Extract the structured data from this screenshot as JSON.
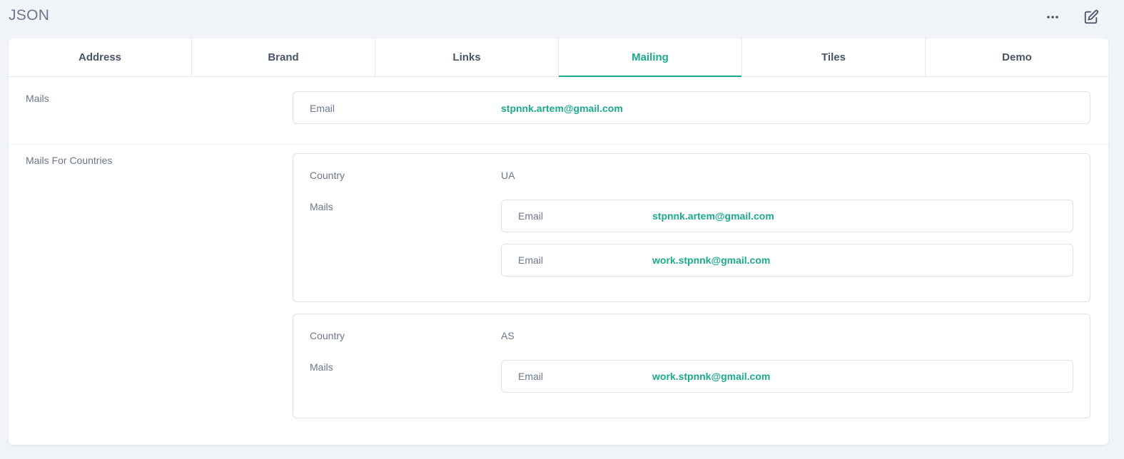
{
  "header": {
    "title": "JSON",
    "actions": [
      {
        "icon": "more-icon"
      },
      {
        "icon": "edit-icon"
      }
    ]
  },
  "tabs": [
    {
      "label": "Address"
    },
    {
      "label": "Brand"
    },
    {
      "label": "Links"
    },
    {
      "label": "Mailing"
    },
    {
      "label": "Tiles"
    },
    {
      "label": "Demo"
    }
  ],
  "active_tab": "Mailing",
  "mails": {
    "label": "Mails",
    "items": [
      {
        "key": "Email",
        "value": "stpnnk.artem@gmail.com"
      }
    ]
  },
  "mails_for_countries": {
    "label": "Mails For Countries",
    "entries": [
      {
        "country_key": "Country",
        "country": "UA",
        "mails_key": "Mails",
        "mails": [
          {
            "key": "Email",
            "value": "stpnnk.artem@gmail.com"
          },
          {
            "key": "Email",
            "value": "work.stpnnk@gmail.com"
          }
        ]
      },
      {
        "country_key": "Country",
        "country": "AS",
        "mails_key": "Mails",
        "mails": [
          {
            "key": "Email",
            "value": "work.stpnnk@gmail.com"
          }
        ]
      }
    ]
  },
  "colors": {
    "accent": "#1aab8a",
    "text_muted": "#6b778c",
    "background": "#f0f4f8"
  }
}
